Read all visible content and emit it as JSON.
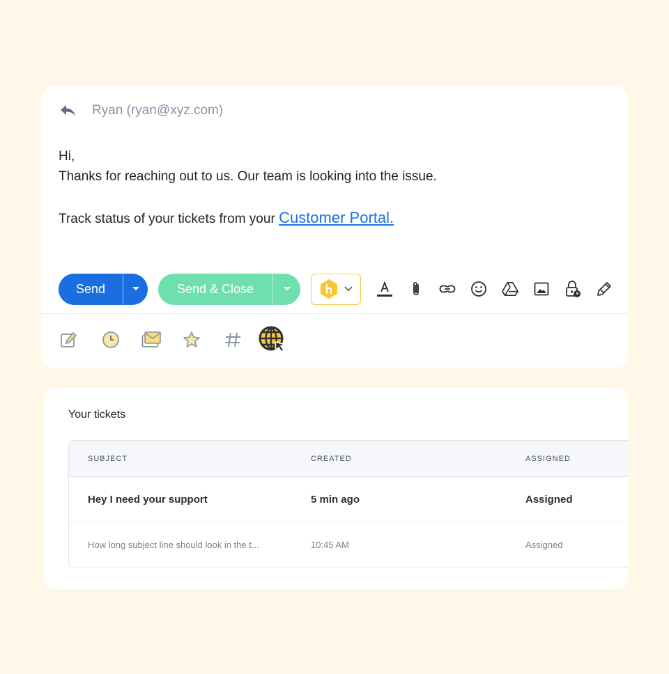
{
  "compose": {
    "reply_to": "Ryan (ryan@xyz.com)",
    "greeting": "Hi,",
    "line1": "Thanks for reaching out to us. Our team is looking into the issue.",
    "line2_prefix": "Track status of your tickets from your ",
    "portal_link": "Customer Portal.",
    "send_label": "Send",
    "send_close_label": "Send & Close"
  },
  "toolbar_icons": [
    "text-color-icon",
    "attachment-icon",
    "link-icon",
    "emoji-icon",
    "drive-icon",
    "image-icon",
    "lock-clock-icon",
    "pen-icon"
  ],
  "bottom_icons": [
    "note-icon",
    "clock-icon",
    "mail-icon",
    "star-icon",
    "hash-icon",
    "globe-cursor-icon"
  ],
  "colors": {
    "background": "#fff8e8",
    "send": "#1a6ee0",
    "send_close": "#6ee0ae",
    "link": "#1a73e8",
    "accent_yellow": "#f2c94c"
  },
  "tickets": {
    "title": "Your tickets",
    "columns": [
      "SUBJECT",
      "CREATED",
      "ASSIGNED"
    ],
    "rows": [
      {
        "subject": "Hey I need your support",
        "created": "5 min ago",
        "assigned": "Assigned"
      },
      {
        "subject": "How long subject line should look in the t...",
        "created": "10:45 AM",
        "assigned": "Assigned"
      }
    ]
  }
}
